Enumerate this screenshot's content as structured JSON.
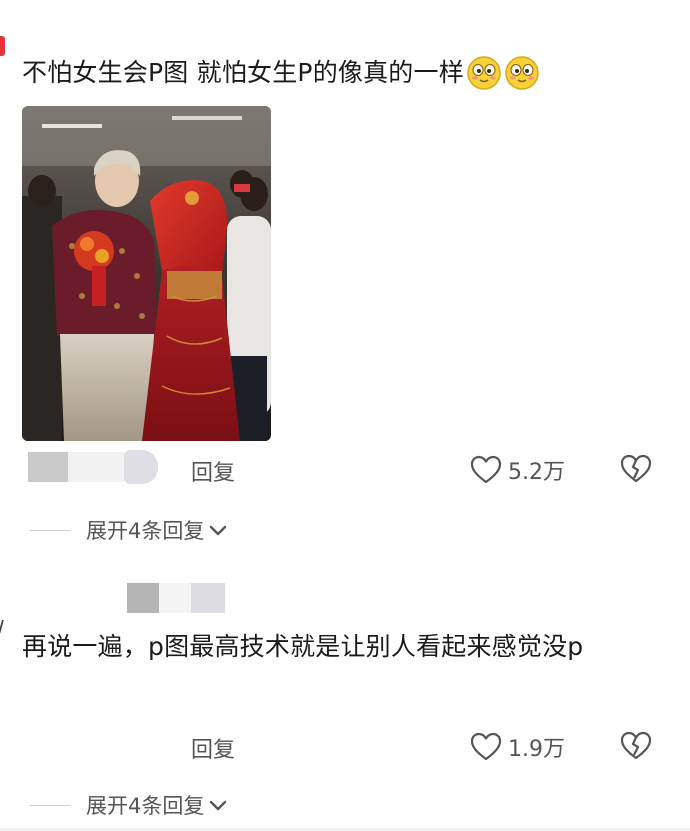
{
  "comments": [
    {
      "text": "不怕女生会P图  就怕女生P的像真的一样",
      "emojis": [
        "smile-emoji",
        "smile-emoji"
      ],
      "reply_label": "回复",
      "like_count": "5.2万",
      "expand_label": "展开4条回复"
    },
    {
      "text": "再说一遍，p图最高技术就是让别人看起来感觉没p",
      "reply_label": "回复",
      "like_count": "1.9万",
      "expand_label": "展开4条回复"
    }
  ],
  "icons": {
    "like": "heart-outline-icon",
    "dislike": "broken-heart-icon",
    "expand": "chevron-down-icon"
  },
  "colors": {
    "text": "#1b1b1b",
    "secondary": "#555555",
    "accent": "#e0353a"
  }
}
